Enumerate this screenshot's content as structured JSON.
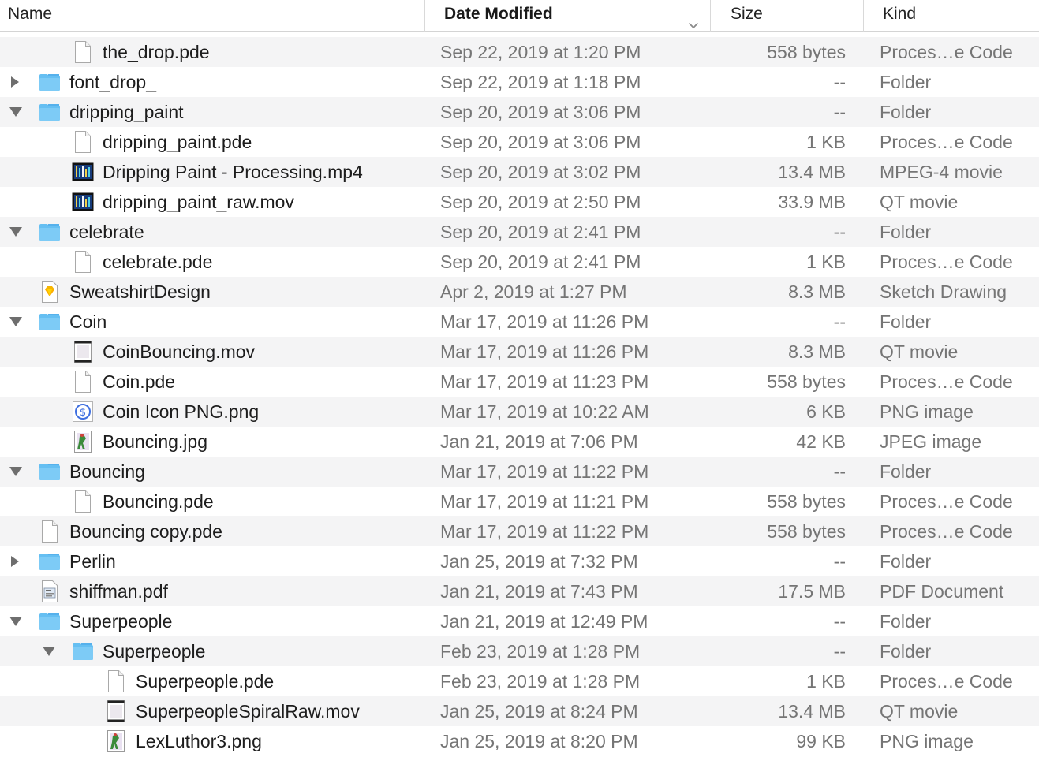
{
  "columns": {
    "name": "Name",
    "date": "Date Modified",
    "size": "Size",
    "kind": "Kind"
  },
  "rows": [
    {
      "name": "the_drop.pde",
      "date": "Sep 22, 2019 at 1:20 PM",
      "size": "558 bytes",
      "kind": "Proces…e Code",
      "level": 1,
      "icon": "document-icon",
      "disclosure": "none"
    },
    {
      "name": "font_drop_",
      "date": "Sep 22, 2019 at 1:18 PM",
      "size": "--",
      "kind": "Folder",
      "level": 0,
      "icon": "folder-icon",
      "disclosure": "collapsed"
    },
    {
      "name": "dripping_paint",
      "date": "Sep 20, 2019 at 3:06 PM",
      "size": "--",
      "kind": "Folder",
      "level": 0,
      "icon": "folder-icon",
      "disclosure": "expanded"
    },
    {
      "name": "dripping_paint.pde",
      "date": "Sep 20, 2019 at 3:06 PM",
      "size": "1 KB",
      "kind": "Proces…e Code",
      "level": 1,
      "icon": "document-icon",
      "disclosure": "none"
    },
    {
      "name": "Dripping Paint - Processing.mp4",
      "date": "Sep 20, 2019 at 3:02 PM",
      "size": "13.4 MB",
      "kind": "MPEG-4 movie",
      "level": 1,
      "icon": "movie-thumbnail-icon",
      "disclosure": "none"
    },
    {
      "name": "dripping_paint_raw.mov",
      "date": "Sep 20, 2019 at 2:50 PM",
      "size": "33.9 MB",
      "kind": "QT movie",
      "level": 1,
      "icon": "movie-thumbnail-icon",
      "disclosure": "none"
    },
    {
      "name": "celebrate",
      "date": "Sep 20, 2019 at 2:41 PM",
      "size": "--",
      "kind": "Folder",
      "level": 0,
      "icon": "folder-icon",
      "disclosure": "expanded"
    },
    {
      "name": "celebrate.pde",
      "date": "Sep 20, 2019 at 2:41 PM",
      "size": "1 KB",
      "kind": "Proces…e Code",
      "level": 1,
      "icon": "document-icon",
      "disclosure": "none"
    },
    {
      "name": "SweatshirtDesign",
      "date": "Apr 2, 2019 at 1:27 PM",
      "size": "8.3 MB",
      "kind": "Sketch Drawing",
      "level": 0,
      "icon": "sketch-file-icon",
      "disclosure": "none"
    },
    {
      "name": "Coin",
      "date": "Mar 17, 2019 at 11:26 PM",
      "size": "--",
      "kind": "Folder",
      "level": 0,
      "icon": "folder-icon",
      "disclosure": "expanded"
    },
    {
      "name": "CoinBouncing.mov",
      "date": "Mar 17, 2019 at 11:26 PM",
      "size": "8.3 MB",
      "kind": "QT movie",
      "level": 1,
      "icon": "movie-file-icon",
      "disclosure": "none"
    },
    {
      "name": "Coin.pde",
      "date": "Mar 17, 2019 at 11:23 PM",
      "size": "558 bytes",
      "kind": "Proces…e Code",
      "level": 1,
      "icon": "document-icon",
      "disclosure": "none"
    },
    {
      "name": "Coin Icon PNG.png",
      "date": "Mar 17, 2019 at 10:22 AM",
      "size": "6 KB",
      "kind": "PNG image",
      "level": 1,
      "icon": "coin-image-icon",
      "disclosure": "none"
    },
    {
      "name": "Bouncing.jpg",
      "date": "Jan 21, 2019 at 7:06 PM",
      "size": "42 KB",
      "kind": "JPEG image",
      "level": 1,
      "icon": "image-thumbnail-icon",
      "disclosure": "none"
    },
    {
      "name": "Bouncing",
      "date": "Mar 17, 2019 at 11:22 PM",
      "size": "--",
      "kind": "Folder",
      "level": 0,
      "icon": "folder-icon",
      "disclosure": "expanded"
    },
    {
      "name": "Bouncing.pde",
      "date": "Mar 17, 2019 at 11:21 PM",
      "size": "558 bytes",
      "kind": "Proces…e Code",
      "level": 1,
      "icon": "document-icon",
      "disclosure": "none"
    },
    {
      "name": "Bouncing copy.pde",
      "date": "Mar 17, 2019 at 11:22 PM",
      "size": "558 bytes",
      "kind": "Proces…e Code",
      "level": 0,
      "icon": "document-icon",
      "disclosure": "none"
    },
    {
      "name": "Perlin",
      "date": "Jan 25, 2019 at 7:32 PM",
      "size": "--",
      "kind": "Folder",
      "level": 0,
      "icon": "folder-icon",
      "disclosure": "collapsed"
    },
    {
      "name": "shiffman.pdf",
      "date": "Jan 21, 2019 at 7:43 PM",
      "size": "17.5 MB",
      "kind": "PDF Document",
      "level": 0,
      "icon": "pdf-icon",
      "disclosure": "none"
    },
    {
      "name": "Superpeople",
      "date": "Jan 21, 2019 at 12:49 PM",
      "size": "--",
      "kind": "Folder",
      "level": 0,
      "icon": "folder-icon",
      "disclosure": "expanded"
    },
    {
      "name": "Superpeople",
      "date": "Feb 23, 2019 at 1:28 PM",
      "size": "--",
      "kind": "Folder",
      "level": 1,
      "icon": "folder-icon",
      "disclosure": "expanded"
    },
    {
      "name": "Superpeople.pde",
      "date": "Feb 23, 2019 at 1:28 PM",
      "size": "1 KB",
      "kind": "Proces…e Code",
      "level": 2,
      "icon": "document-icon",
      "disclosure": "none"
    },
    {
      "name": "SuperpeopleSpiralRaw.mov",
      "date": "Jan 25, 2019 at 8:24 PM",
      "size": "13.4 MB",
      "kind": "QT movie",
      "level": 2,
      "icon": "movie-file-icon",
      "disclosure": "none"
    },
    {
      "name": "LexLuthor3.png",
      "date": "Jan 25, 2019 at 8:20 PM",
      "size": "99 KB",
      "kind": "PNG image",
      "level": 2,
      "icon": "image-thumbnail-icon",
      "disclosure": "none"
    }
  ]
}
